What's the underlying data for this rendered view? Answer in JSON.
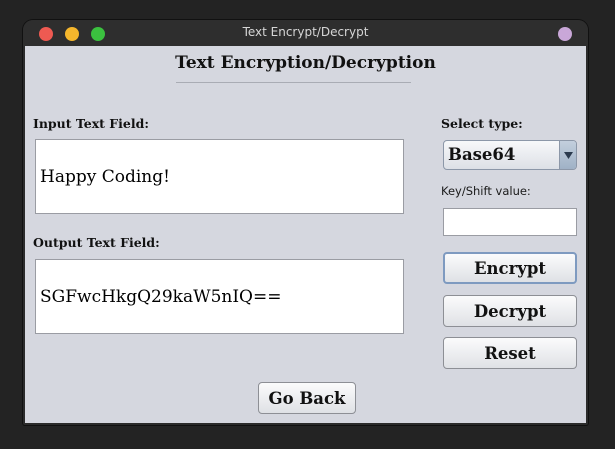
{
  "window": {
    "title": "Text Encrypt/Decrypt"
  },
  "heading": "Text Encryption/Decryption",
  "input": {
    "label": "Input Text Field:",
    "value": "Happy Coding!"
  },
  "output": {
    "label": "Output Text Field:",
    "value": "SGFwcHkgQ29kaW5nIQ=="
  },
  "type_select": {
    "label": "Select type:",
    "selected": "Base64",
    "icon": "chevron-down-icon"
  },
  "key_field": {
    "label": "Key/Shift value:",
    "value": ""
  },
  "buttons": {
    "encrypt": "Encrypt",
    "decrypt": "Decrypt",
    "reset": "Reset",
    "go_back": "Go Back"
  },
  "colors": {
    "panel_background": "#d5d7df",
    "traffic_red": "#ee5a52",
    "traffic_yellow": "#f5b62c",
    "traffic_green": "#3bc13f",
    "focus_border": "#7e9ac0"
  }
}
